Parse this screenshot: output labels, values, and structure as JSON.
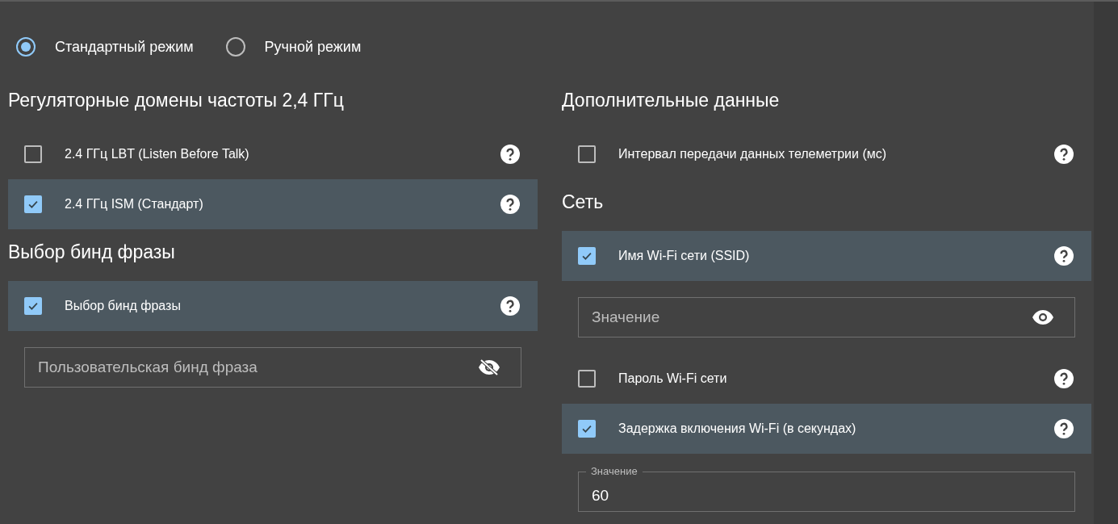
{
  "mode_options": [
    {
      "label": "Стандартный режим",
      "selected": true
    },
    {
      "label": "Ручной режим",
      "selected": false
    }
  ],
  "columns": [
    [
      {
        "title": "Регуляторные домены частоты 2,4 ГГц",
        "items": [
          {
            "kind": "checkbox",
            "label": "2.4 ГГц LBT (Listen Before Talk)",
            "checked": false
          },
          {
            "kind": "checkbox",
            "label": "2.4 ГГц ISM (Стандарт)",
            "checked": true
          }
        ]
      },
      {
        "title": "Выбор бинд фразы",
        "items": [
          {
            "kind": "checkbox",
            "label": "Выбор бинд фразы",
            "checked": true
          },
          {
            "kind": "secret_field",
            "placeholder": "Пользовательская бинд фраза",
            "revealed": false
          }
        ]
      }
    ],
    [
      {
        "title": "Дополнительные данные",
        "items": [
          {
            "kind": "checkbox",
            "label": "Интервал передачи данных телеметрии (мс)",
            "checked": false
          }
        ]
      },
      {
        "title": "Сеть",
        "items": [
          {
            "kind": "checkbox",
            "label": "Имя Wi-Fi сети (SSID)",
            "checked": true
          },
          {
            "kind": "secret_field",
            "placeholder": "Значение",
            "revealed": true
          },
          {
            "kind": "checkbox",
            "label": "Пароль Wi-Fi сети",
            "checked": false
          },
          {
            "kind": "checkbox",
            "label": "Задержка включения Wi-Fi (в секундах)",
            "checked": true
          },
          {
            "kind": "value_field",
            "label": "Значение",
            "value": "60"
          }
        ]
      }
    ]
  ]
}
